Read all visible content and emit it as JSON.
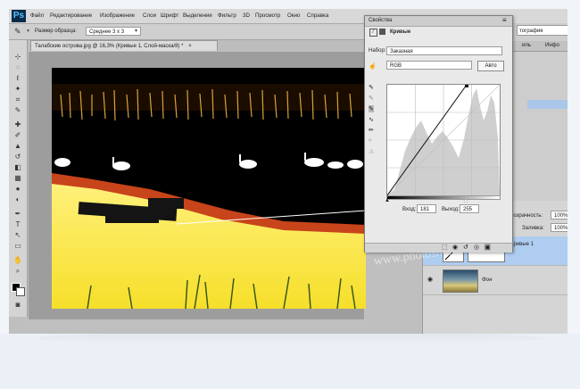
{
  "app": {
    "logo": "Ps"
  },
  "menu": [
    "Файл",
    "Редактирование",
    "Изображение",
    "Слои",
    "Шрифт",
    "Выделение",
    "Фильтр",
    "3D",
    "Просмотр",
    "Окно",
    "Справка"
  ],
  "options": {
    "sample_label": "Размер образца:",
    "sample_value": "Среднее 3 x 3"
  },
  "document": {
    "tab_title": "Талабские острова.jpg @ 16,3% (Кривые 1, Слой-маска/8) *",
    "close_glyph": "×"
  },
  "right_dock": {
    "search_value": "тография",
    "tab_1": "иль",
    "tab_2": "Инфо"
  },
  "properties": {
    "title": "Свойства",
    "panel_name": "Кривые",
    "preset_label": "Набор:",
    "preset_value": "Заказная",
    "channel_value": "RGB",
    "auto_label": "Авто",
    "input_label": "Вход:",
    "input_value": "181",
    "output_label": "Выход:",
    "output_value": "255"
  },
  "layers": {
    "opacity_label": "розрачность:",
    "opacity_value": "100%",
    "fill_label": "Заливка:",
    "fill_value": "100%",
    "curves_layer": "Кривые 1",
    "bg_layer": "Фон"
  },
  "watermark": "www.photoshop-master.ru",
  "colors": {
    "accent": "#3b8ad9",
    "panel": "#e9e9e9",
    "frame": "#bfbfbf"
  }
}
